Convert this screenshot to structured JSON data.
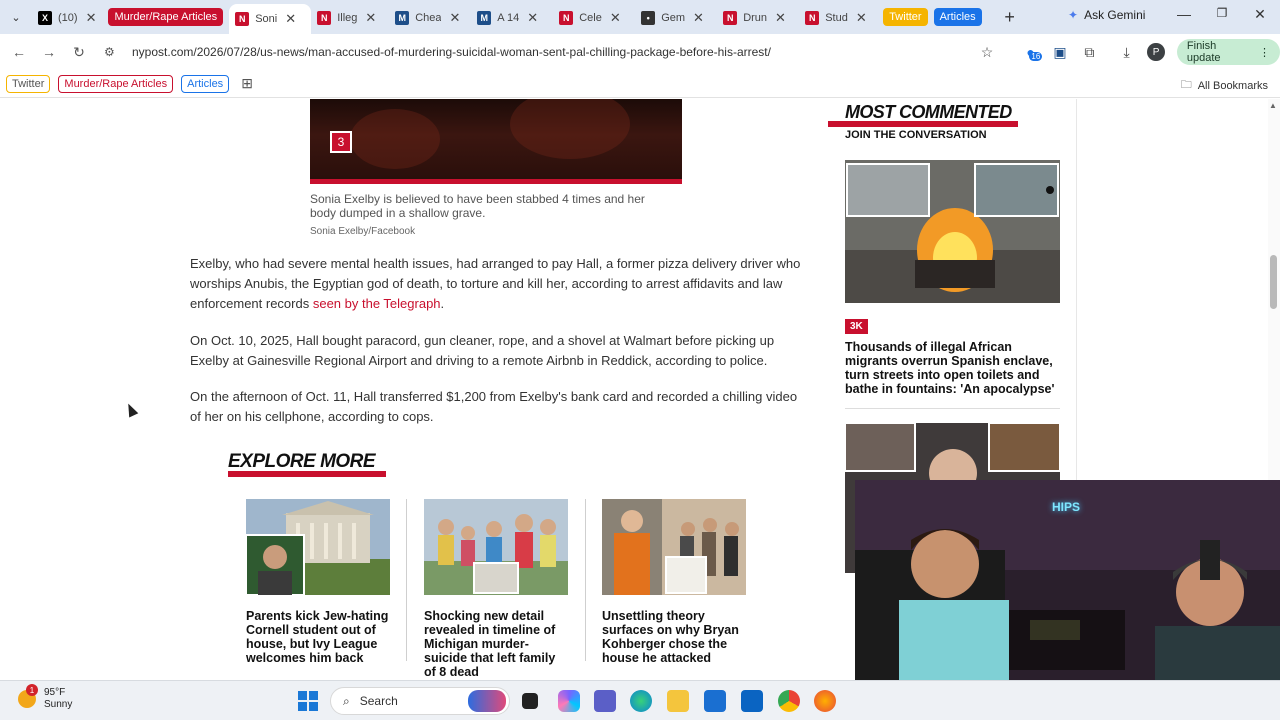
{
  "browser": {
    "tabs": [
      {
        "label": "(10)",
        "favicon": "x-logo",
        "fav_color": "#000000",
        "fav_text": "X"
      },
      {
        "label": "Murder/Rape Articles",
        "type": "group",
        "color": "#c8102e"
      },
      {
        "label": "Soni",
        "favicon": "nypost-logo",
        "fav_color": "#c8102e",
        "fav_text": "N",
        "active": true
      },
      {
        "label": "Illeg",
        "favicon": "nypost-logo",
        "fav_color": "#c8102e",
        "fav_text": "N"
      },
      {
        "label": "Chea",
        "favicon": "m-logo",
        "fav_color": "#1d4e89",
        "fav_text": "M"
      },
      {
        "label": "A 14",
        "favicon": "m-logo",
        "fav_color": "#1d4e89",
        "fav_text": "M"
      },
      {
        "label": "Cele",
        "favicon": "nypost-logo",
        "fav_color": "#c8102e",
        "fav_text": "N"
      },
      {
        "label": "Gem",
        "favicon": "dots-icon",
        "fav_color": "#333333",
        "fav_text": "•••"
      },
      {
        "label": "Drun",
        "favicon": "nypost-logo",
        "fav_color": "#c8102e",
        "fav_text": "N"
      },
      {
        "label": "Stud",
        "favicon": "nypost-logo",
        "fav_color": "#c8102e",
        "fav_text": "N"
      }
    ],
    "group_twitter": "Twitter",
    "group_articles": "Articles",
    "new_tab": "+",
    "ask_gemini": "Ask Gemini",
    "url": "nypost.com/2026/07/28/us-news/man-accused-of-murdering-suicidal-woman-sent-pal-chilling-package-before-his-arrest/",
    "extensions_badge": "16",
    "profile_initial": "P",
    "finish_update": "Finish update",
    "bookmarks": {
      "twitter": "Twitter",
      "murder": "Murder/Rape Articles",
      "articles": "Articles",
      "all": "All Bookmarks"
    }
  },
  "article": {
    "gallery_count": "3",
    "caption": "Sonia Exelby is believed to have been stabbed 4 times and her body dumped in a shallow grave.",
    "credit": "Sonia Exelby/Facebook",
    "para1_pre": "Exelby, who had severe mental health issues, had arranged to pay Hall, a former pizza delivery driver who worships Anubis, the Egyptian god of death, to torture and kill her, according to arrest affidavits and law enforcement records ",
    "para1_link": "seen by the Telegraph",
    "para1_post": ".",
    "para2": "On Oct. 10, 2025, Hall bought paracord, gun cleaner, rope, and a shovel at Walmart before picking up Exelby at Gainesville Regional Airport and driving to a remote Airbnb in Reddick, according to police.",
    "para3": "On the afternoon of Oct. 11, Hall transferred $1,200 from Exelby's bank card and recorded a chilling video of her on his cellphone, according to cops."
  },
  "explore": {
    "title": "EXPLORE MORE",
    "items": [
      {
        "title": "Parents kick Jew-hating Cornell student out of house, but Ivy League welcomes him back"
      },
      {
        "title": "Shocking new detail revealed in timeline of Michigan murder-suicide that left family of 8 dead"
      },
      {
        "title": "Unsettling theory surfaces on why Bryan Kohberger chose the house he attacked"
      }
    ]
  },
  "sidebar": {
    "title": "MOST COMMENTED",
    "subtitle": "JOIN THE CONVERSATION",
    "item1_count": "3K",
    "item1_title": "Thousands of illegal African migrants overrun Spanish enclave, turn streets into open toilets and bathe in fountains: 'An apocalypse'"
  },
  "webcam": {
    "neon_text": "HIPS"
  },
  "taskbar": {
    "temp": "95°F",
    "condition": "Sunny",
    "notification_count": "1",
    "search": "Search"
  },
  "colors": {
    "brand_red": "#c8102e",
    "tab_strip": "#dfe7f3",
    "update_green": "#c7ecd3",
    "articles_blue": "#1a73e8",
    "twitter_yellow": "#f5b400"
  }
}
